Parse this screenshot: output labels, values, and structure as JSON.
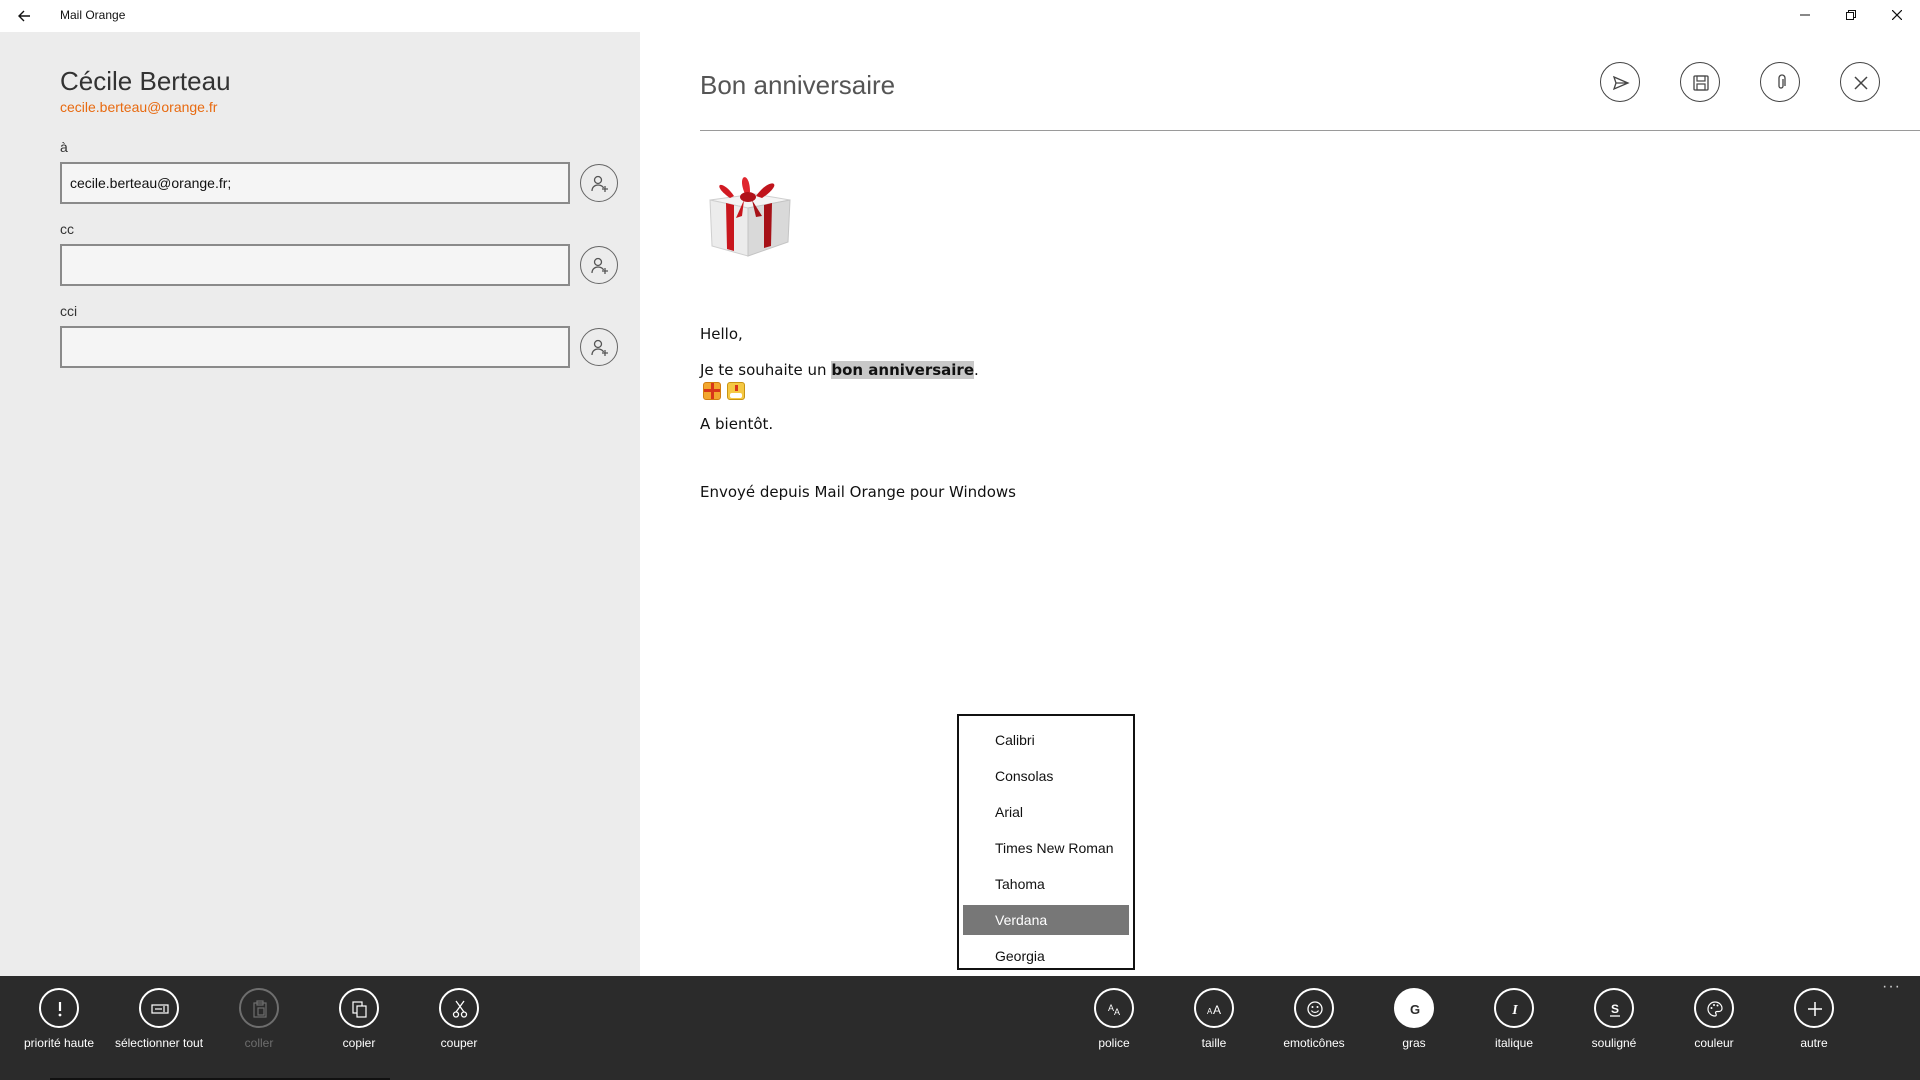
{
  "window": {
    "title": "Mail Orange",
    "back_icon": "arrow-left-icon",
    "min_symbol": "—",
    "max_symbol": "❐",
    "close_symbol": "✕"
  },
  "sender": {
    "name": "Cécile Berteau",
    "email": "cecile.berteau@orange.fr"
  },
  "fields": {
    "to_label": "à",
    "to_value": "cecile.berteau@orange.fr;",
    "cc_label": "cc",
    "cc_value": "",
    "bcc_label": "cci",
    "bcc_value": ""
  },
  "message": {
    "subject": "Bon anniversaire",
    "hello": "Hello,",
    "wish_prefix": "Je te souhaite un ",
    "wish_bold": "bon anniversaire",
    "wish_suffix": ".",
    "emoticons": [
      "gift-emoticon",
      "cake-emoticon"
    ],
    "goodbye": "A bientôt.",
    "signature": "Envoyé depuis Mail Orange pour Windows"
  },
  "top_actions": [
    "send-icon",
    "save-icon",
    "attach-icon",
    "close-icon"
  ],
  "font_menu": {
    "options": [
      "Calibri",
      "Consolas",
      "Arial",
      "Times New Roman",
      "Tahoma",
      "Verdana",
      "Georgia"
    ],
    "selected": "Verdana"
  },
  "appbar": {
    "left": [
      {
        "label": "priorité haute",
        "icon": "exclamation-icon",
        "enabled": true
      },
      {
        "label": "sélectionner tout",
        "icon": "select-all-icon",
        "enabled": true
      },
      {
        "label": "coller",
        "icon": "paste-icon",
        "enabled": false
      },
      {
        "label": "copier",
        "icon": "copy-icon",
        "enabled": true
      },
      {
        "label": "couper",
        "icon": "scissors-icon",
        "enabled": true
      }
    ],
    "right": [
      {
        "label": "police",
        "icon": "font-icon"
      },
      {
        "label": "taille",
        "icon": "font-size-icon"
      },
      {
        "label": "emoticônes",
        "icon": "smiley-icon"
      },
      {
        "label": "gras",
        "icon": "bold-icon",
        "glyph": "G",
        "active": true
      },
      {
        "label": "italique",
        "icon": "italic-icon",
        "glyph": "I"
      },
      {
        "label": "souligné",
        "icon": "underline-icon",
        "glyph": "S"
      },
      {
        "label": "couleur",
        "icon": "palette-icon"
      },
      {
        "label": "autre",
        "icon": "plus-icon"
      }
    ],
    "more": "···"
  },
  "colors": {
    "accent": "#e86a10",
    "left_panel": "#ececec",
    "appbar": "#2b2b2b",
    "selection": "#777777"
  }
}
